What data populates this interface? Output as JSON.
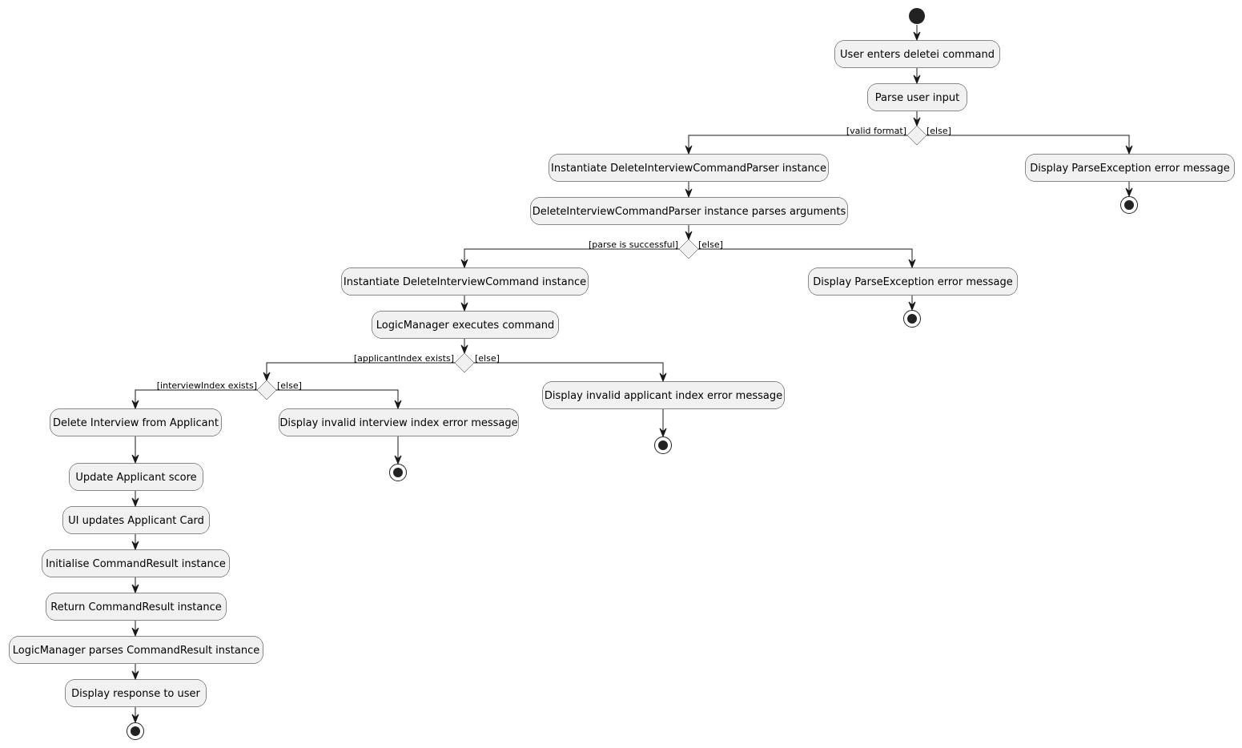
{
  "diagram": {
    "type": "activity",
    "activities": {
      "enter": "User enters deletei command",
      "parse_input": "Parse user input",
      "inst_parser": "Instantiate DeleteInterviewCommandParser instance",
      "parser_parses": "DeleteInterviewCommandParser instance parses arguments",
      "err_format": "Display ParseException error message",
      "inst_command": "Instantiate DeleteInterviewCommand instance",
      "execute": "LogicManager executes command",
      "err_parse": "Display ParseException error message",
      "err_applicant": "Display invalid applicant index error message",
      "delete": "Delete Interview from Applicant",
      "err_interview": "Display invalid interview index error message",
      "update_score": "Update Applicant score",
      "ui_update": "UI updates Applicant Card",
      "init_result": "Initialise CommandResult instance",
      "return_result": "Return CommandResult instance",
      "parse_result": "LogicManager parses CommandResult instance",
      "display_response": "Display response to user"
    },
    "guards": {
      "valid_format": "[valid format]",
      "else1": "[else]",
      "parse_ok": "[parse is successful]",
      "else2": "[else]",
      "applicant_exists": "[applicantIndex exists]",
      "else3": "[else]",
      "interview_exists": "[interviewIndex exists]",
      "else4": "[else]"
    }
  }
}
